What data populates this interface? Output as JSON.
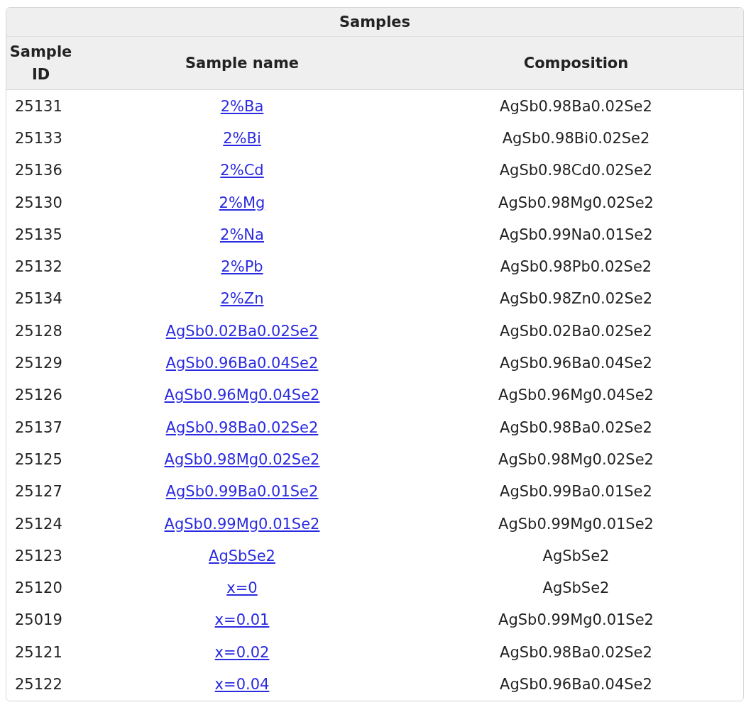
{
  "table": {
    "title": "Samples",
    "columns": [
      "Sample ID",
      "Sample name",
      "Composition"
    ],
    "rows": [
      {
        "id": "25131",
        "name": "2%Ba",
        "composition": "AgSb0.98Ba0.02Se2"
      },
      {
        "id": "25133",
        "name": "2%Bi",
        "composition": "AgSb0.98Bi0.02Se2"
      },
      {
        "id": "25136",
        "name": "2%Cd",
        "composition": "AgSb0.98Cd0.02Se2"
      },
      {
        "id": "25130",
        "name": "2%Mg",
        "composition": "AgSb0.98Mg0.02Se2"
      },
      {
        "id": "25135",
        "name": "2%Na",
        "composition": "AgSb0.99Na0.01Se2"
      },
      {
        "id": "25132",
        "name": "2%Pb",
        "composition": "AgSb0.98Pb0.02Se2"
      },
      {
        "id": "25134",
        "name": "2%Zn",
        "composition": "AgSb0.98Zn0.02Se2"
      },
      {
        "id": "25128",
        "name": "AgSb0.02Ba0.02Se2",
        "composition": "AgSb0.02Ba0.02Se2"
      },
      {
        "id": "25129",
        "name": "AgSb0.96Ba0.04Se2",
        "composition": "AgSb0.96Ba0.04Se2"
      },
      {
        "id": "25126",
        "name": "AgSb0.96Mg0.04Se2",
        "composition": "AgSb0.96Mg0.04Se2"
      },
      {
        "id": "25137",
        "name": "AgSb0.98Ba0.02Se2",
        "composition": "AgSb0.98Ba0.02Se2"
      },
      {
        "id": "25125",
        "name": "AgSb0.98Mg0.02Se2",
        "composition": "AgSb0.98Mg0.02Se2"
      },
      {
        "id": "25127",
        "name": "AgSb0.99Ba0.01Se2",
        "composition": "AgSb0.99Ba0.01Se2"
      },
      {
        "id": "25124",
        "name": "AgSb0.99Mg0.01Se2",
        "composition": "AgSb0.99Mg0.01Se2"
      },
      {
        "id": "25123",
        "name": "AgSbSe2",
        "composition": "AgSbSe2"
      },
      {
        "id": "25120",
        "name": "x=0",
        "composition": "AgSbSe2"
      },
      {
        "id": "25019",
        "name": "x=0.01",
        "composition": "AgSb0.99Mg0.01Se2"
      },
      {
        "id": "25121",
        "name": "x=0.02",
        "composition": "AgSb0.98Ba0.02Se2"
      },
      {
        "id": "25122",
        "name": "x=0.04",
        "composition": "AgSb0.96Ba0.04Se2"
      }
    ]
  }
}
